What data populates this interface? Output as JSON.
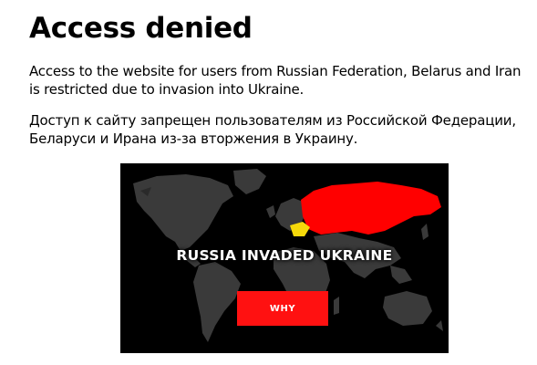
{
  "page": {
    "title": "Access denied",
    "message_en": "Access to the website for users from Russian Federation, Belarus and Iran is restricted due to invasion into Ukraine.",
    "message_ru": "Доступ к сайту запрещен пользователям из Российской Федерации, Беларуси и Ирана из-за вторжения в Украину."
  },
  "banner": {
    "headline": "RUSSIA INVADED UKRAINE",
    "button_label": "WHY",
    "colors": {
      "background": "#000000",
      "land": "#3a3a3a",
      "russia": "#ff0000",
      "ukraine": "#f5d90a",
      "button": "#ff1111"
    }
  }
}
